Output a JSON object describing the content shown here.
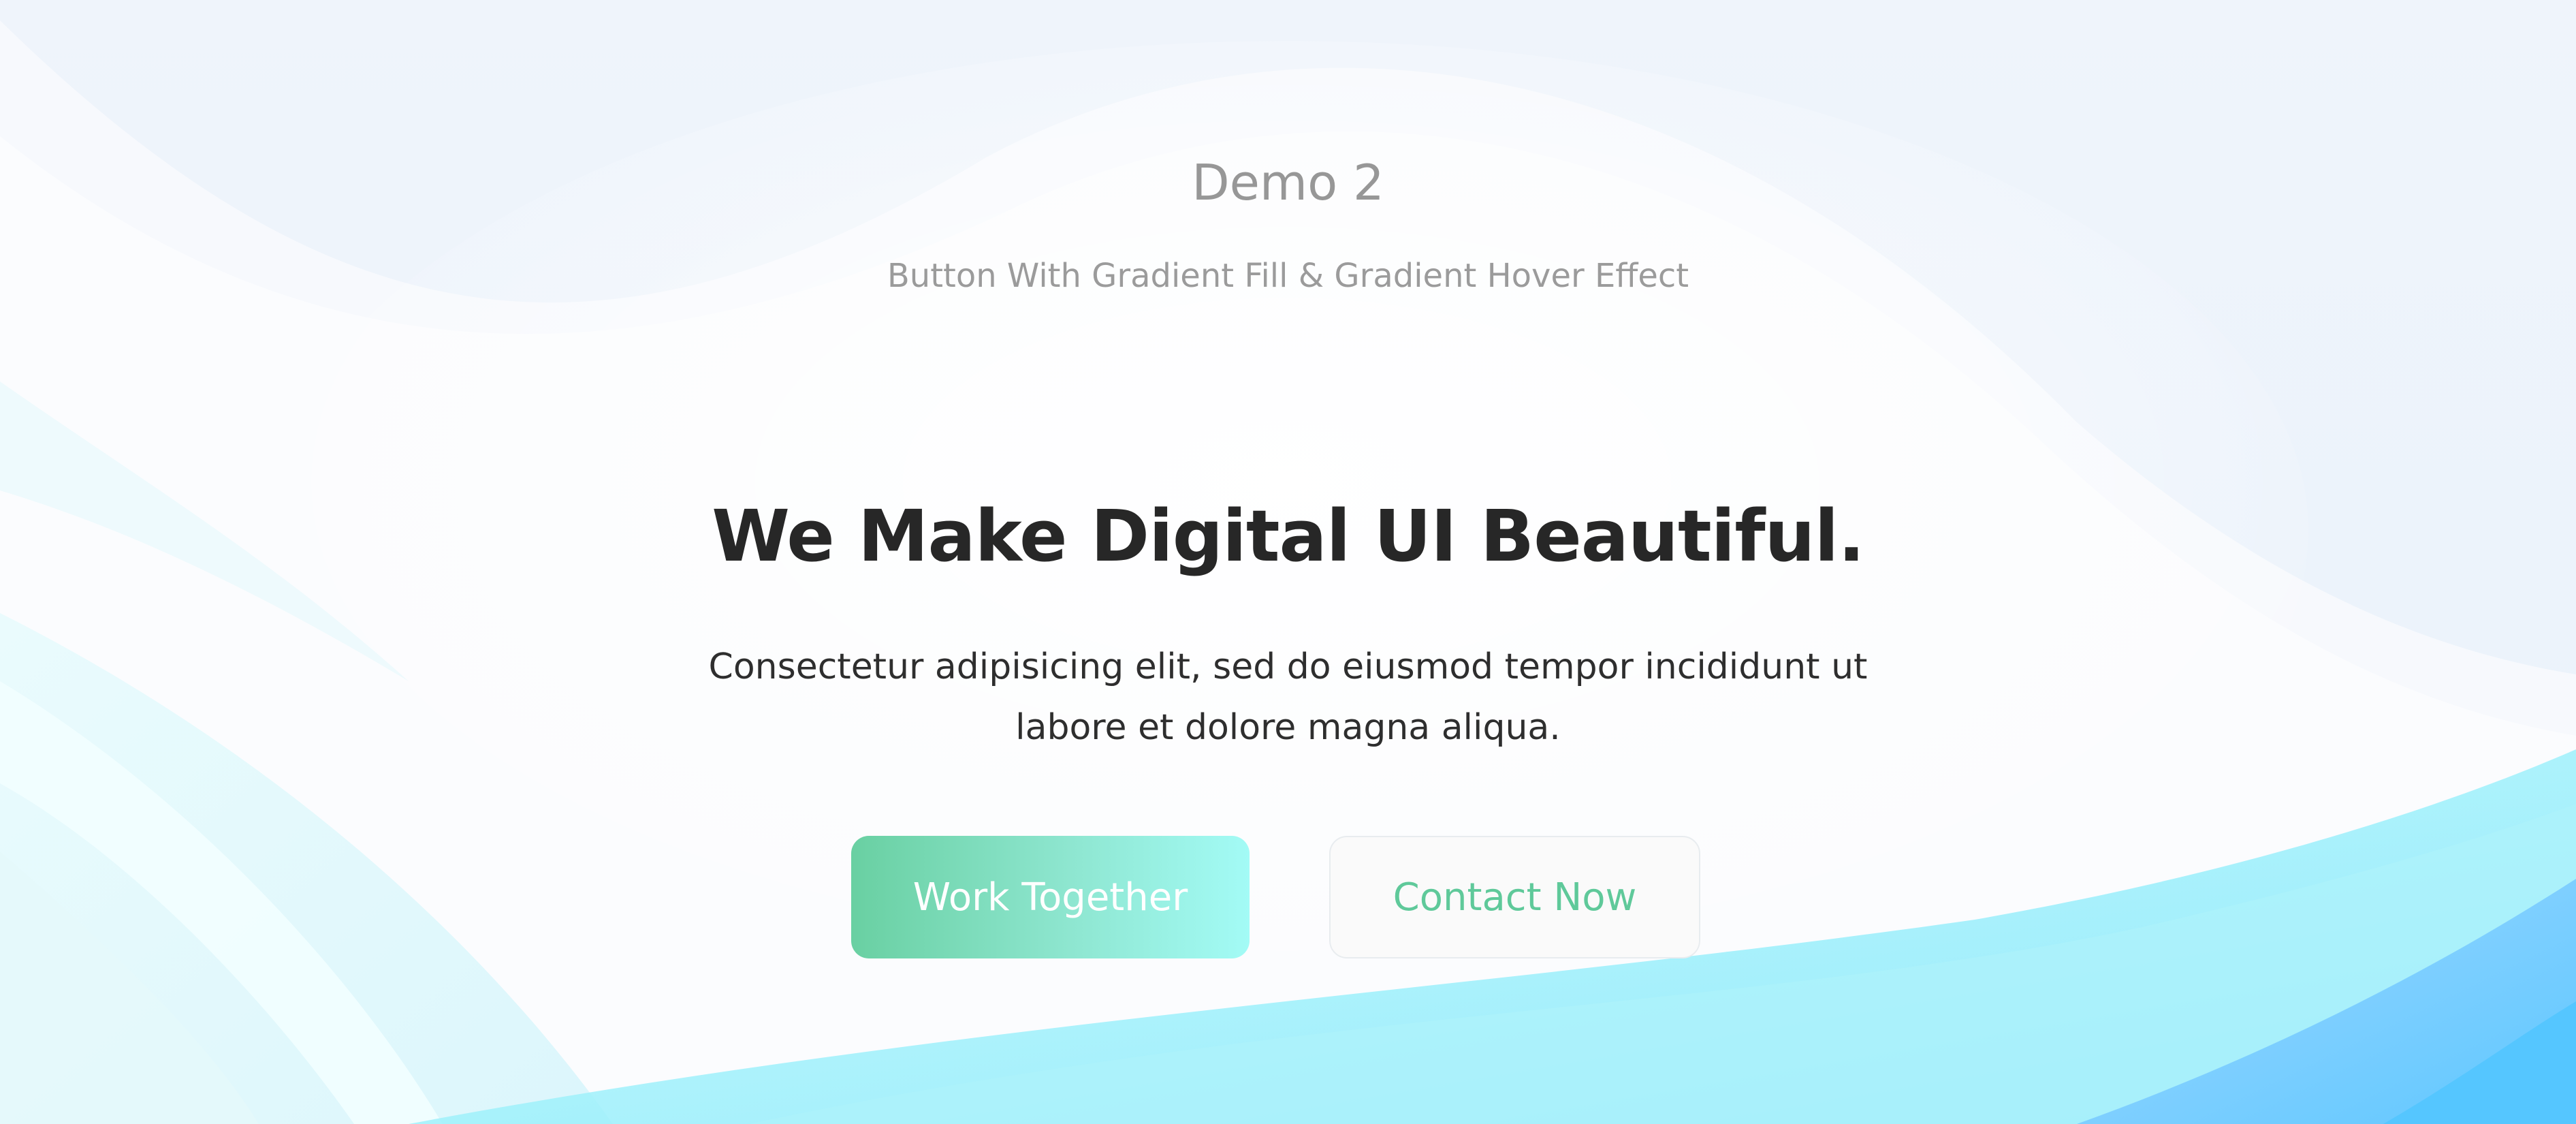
{
  "demo": {
    "title": "Demo 2",
    "subtitle": "Button With Gradient Fill & Gradient Hover Effect"
  },
  "hero": {
    "heading": "We Make Digital UI Beautiful.",
    "text_line1": "Consectetur adipisicing elit, sed do eiusmod tempor incididunt ut",
    "text_line2": "labore et dolore magna aliqua."
  },
  "buttons": {
    "primary_label": "Work Together",
    "secondary_label": "Contact Now"
  },
  "colors": {
    "heading": "#272727",
    "muted_text": "#979797",
    "accent_green": "#5fc99a",
    "gradient_start": "#69d0a2",
    "gradient_end": "#a3fbf6",
    "wave_cyan": "#8ef0fb",
    "wave_blue": "#55c4ff"
  }
}
